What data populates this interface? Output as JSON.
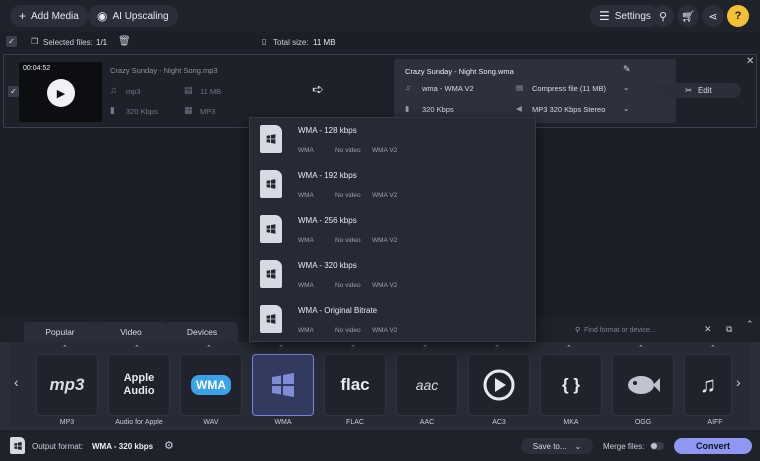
{
  "topbar": {
    "add_media": "Add Media",
    "ai_upscaling": "AI Upscaling",
    "settings": "Settings",
    "help": "?"
  },
  "filebar": {
    "selected_files": "Selected files:",
    "selected_count": "1/1",
    "total_size_label": "Total size:",
    "total_size_value": "11 MB"
  },
  "file": {
    "time": "00:04:52",
    "name": "Crazy Sunday - Night Song.mp3",
    "format": "mp3",
    "size": "11 MB",
    "bitrate": "320 Kbps",
    "container": "MP3",
    "output_name": "Crazy Sunday - Night Song.wma",
    "output_codec": "wma - WMA V2",
    "output_bitrate": "320 Kbps",
    "compress": "Compress file (11 MB)",
    "audio": "MP3 320 Kbps Stereo",
    "edit": "Edit"
  },
  "presets": [
    {
      "name": "WMA - 128 kbps",
      "c1": "WMA",
      "c2": "No video",
      "c3": "WMA V2"
    },
    {
      "name": "WMA - 192 kbps",
      "c1": "WMA",
      "c2": "No video",
      "c3": "WMA V2"
    },
    {
      "name": "WMA - 256 kbps",
      "c1": "WMA",
      "c2": "No video",
      "c3": "WMA V2"
    },
    {
      "name": "WMA - 320 kbps",
      "c1": "WMA",
      "c2": "No video",
      "c3": "WMA V2"
    },
    {
      "name": "WMA - Original Bitrate",
      "c1": "WMA",
      "c2": "No video",
      "c3": "WMA V2"
    }
  ],
  "tabs": [
    "Popular",
    "Video",
    "Devices"
  ],
  "search": {
    "placeholder": "Find format or device..."
  },
  "formats": [
    {
      "label": "MP3",
      "text": "mp3"
    },
    {
      "label": "Audio for Apple",
      "text": "Apple Audio"
    },
    {
      "label": "WAV",
      "text": "WMA"
    },
    {
      "label": "WMA",
      "text": ""
    },
    {
      "label": "FLAC",
      "text": "flac"
    },
    {
      "label": "AAC",
      "text": "aac"
    },
    {
      "label": "AC3",
      "text": ""
    },
    {
      "label": "MKA",
      "text": "{ }"
    },
    {
      "label": "OGG",
      "text": ""
    },
    {
      "label": "AIFF",
      "text": "♫"
    }
  ],
  "footer": {
    "output_format_label": "Output format:",
    "output_format_value": "WMA - 320 kbps",
    "save_to": "Save to...",
    "merge_files": "Merge files:",
    "convert": "Convert"
  },
  "colors": {
    "accent": "#8e98f2",
    "help": "#f3c232",
    "selected_card": "#323a60"
  }
}
